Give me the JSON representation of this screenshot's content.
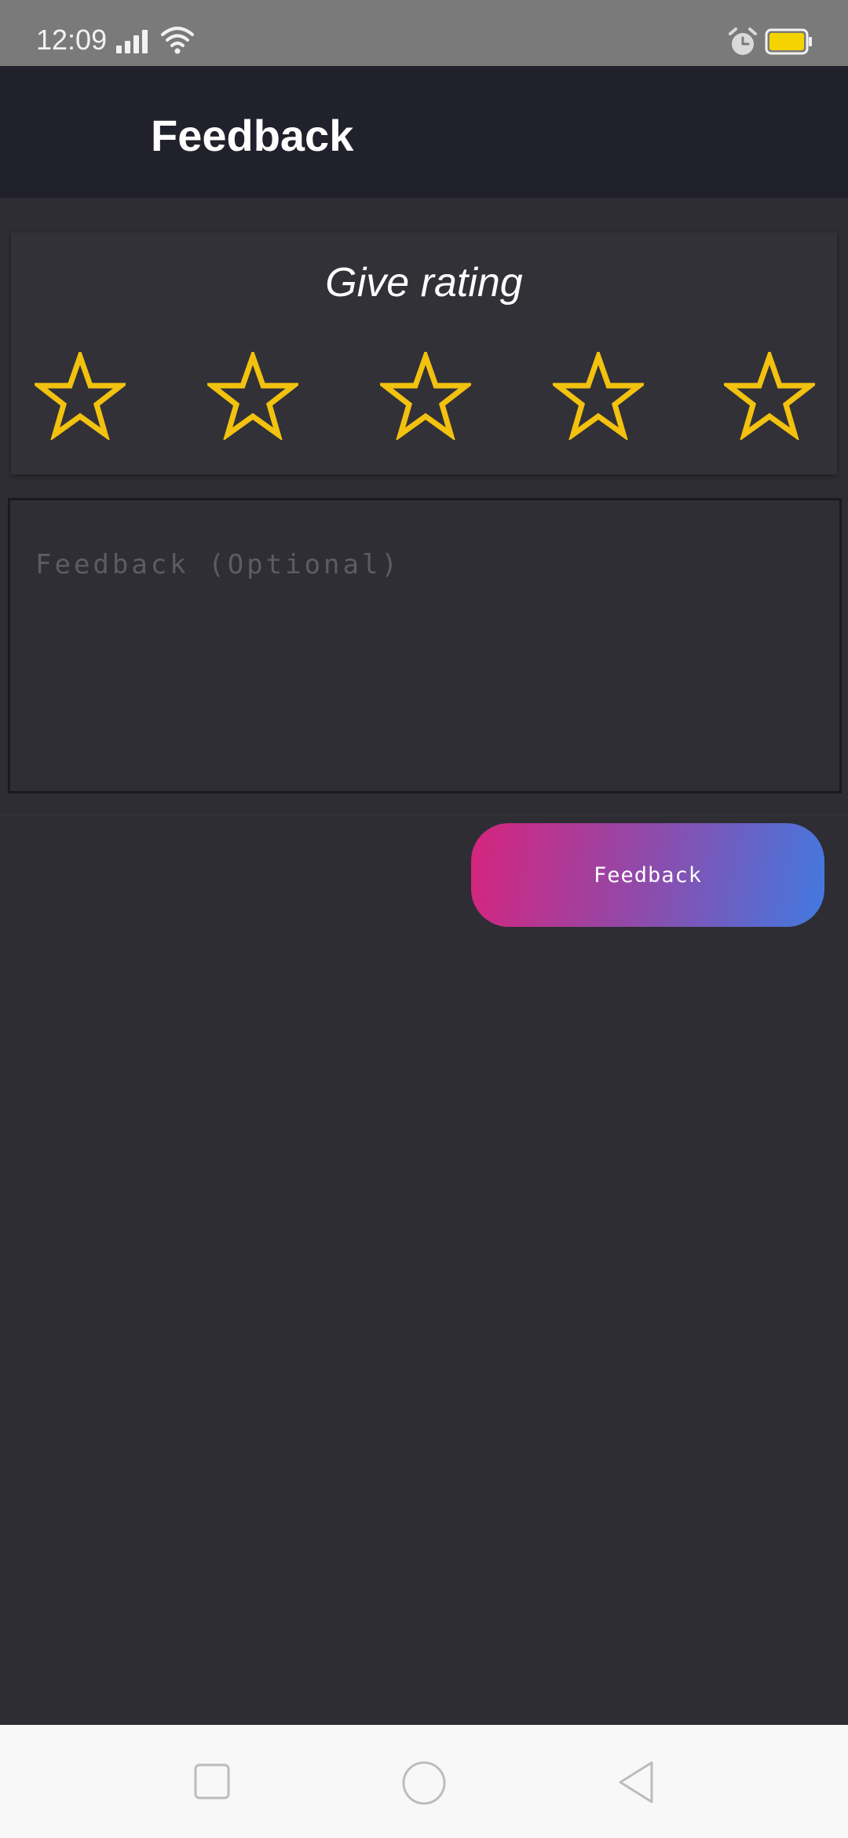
{
  "status_bar": {
    "time": "12:09",
    "icons": [
      "signal-icon",
      "wifi-icon",
      "alarm-icon",
      "battery-icon"
    ],
    "battery_color": "#f5d300"
  },
  "app_bar": {
    "title": "Feedback",
    "background": "#20212b"
  },
  "rating": {
    "title": "Give rating",
    "max_stars": 5,
    "selected": 0,
    "star_color": "#f2c20f"
  },
  "feedback": {
    "placeholder": "Feedback (Optional)",
    "value": ""
  },
  "submit": {
    "label": "Feedback",
    "gradient": [
      "#d6247d",
      "#4279e0"
    ]
  },
  "nav_bar": {
    "icons": [
      "recent-apps-icon",
      "home-icon",
      "back-icon"
    ]
  }
}
